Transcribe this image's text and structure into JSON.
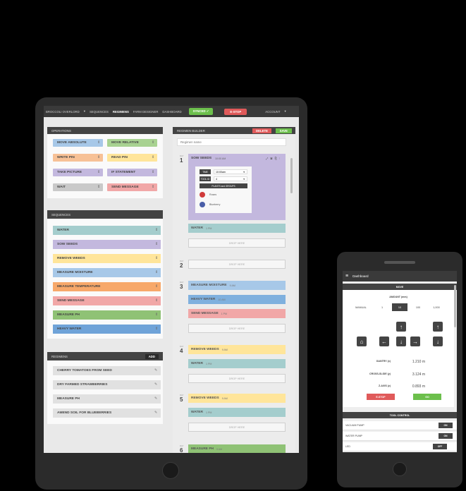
{
  "nav": {
    "device": "BROCCOLI OVERLORD",
    "device_caret": "▾",
    "items": [
      "SEQUENCES",
      "REGIMENS",
      "FARM DESIGNER",
      "DASHBOARD"
    ],
    "synced": "SYNCED ✓",
    "estop": "E-STOP",
    "account": "ACCOUNT",
    "account_caret": "▾"
  },
  "operations": {
    "title": "OPERATIONS",
    "items": [
      {
        "label": "MOVE ABSOLUTE",
        "color": "#a7c8e8"
      },
      {
        "label": "MOVE RELATIVE",
        "color": "#a8d291"
      },
      {
        "label": "WRITE PIN",
        "color": "#f7c196"
      },
      {
        "label": "READ PIN",
        "color": "#ffe59a"
      },
      {
        "label": "TAKE PICTURE",
        "color": "#c3b8de"
      },
      {
        "label": "IF STATEMENT",
        "color": "#c3b8de"
      },
      {
        "label": "WAIT",
        "color": "#c9c9c9"
      },
      {
        "label": "SEND MESSAGE",
        "color": "#f1a7a7"
      }
    ]
  },
  "sequences": {
    "title": "SEQUENCES",
    "items": [
      {
        "label": "WATER",
        "color": "#a4cdcd"
      },
      {
        "label": "SOW SEEDS",
        "color": "#c3b8de"
      },
      {
        "label": "REMOVE WEEDS",
        "color": "#ffe59a"
      },
      {
        "label": "MEASURE MOISTURE",
        "color": "#a7c8e8"
      },
      {
        "label": "MEASURE TEMPERATURE",
        "color": "#f7a86a"
      },
      {
        "label": "SEND MESSAGE",
        "color": "#f1a7a7"
      },
      {
        "label": "MEASURE PH",
        "color": "#8fc275"
      },
      {
        "label": "HEAVY WATER",
        "color": "#6fa3d8"
      }
    ]
  },
  "regimens": {
    "title": "REGIMENS",
    "add": "ADD",
    "items": [
      "CHERRY TOMATOES FROM SEED",
      "DRY FARMED STRAWBERRIES",
      "MEASURE PH",
      "AMEND SOIL FOR BLUEBERRIES"
    ]
  },
  "builder": {
    "title": "REGIMEN BUILDER",
    "delete": "DELETE",
    "save": "SAVE",
    "name_placeholder": "Regimen name",
    "day_label": "DAY",
    "drop": "DROP HERE",
    "sow": {
      "title": "SOW SEEDS",
      "time": "10:00 AM",
      "time_label": "TIME",
      "time_value": "10:00am",
      "tool_label": "TOOL ID",
      "tool_value": "4",
      "plants_header": "PLANTS and GROUPS",
      "plants": [
        "Roses",
        "Blueberry"
      ]
    },
    "days": [
      {
        "num": "1",
        "items": [
          {
            "label": "WATER",
            "time": "1 PM"
          }
        ]
      },
      {
        "num": "2",
        "items": []
      },
      {
        "num": "3",
        "items": [
          {
            "label": "MEASURE MOISTURE",
            "time": "9 AM"
          },
          {
            "label": "HEAVY WATER",
            "time": "10 AM"
          },
          {
            "label": "SEND MESSAGE",
            "time": "1 PM"
          }
        ]
      },
      {
        "num": "4",
        "items": [
          {
            "label": "REMOVE WEEDS",
            "time": "9 AM"
          },
          {
            "label": "WATER",
            "time": "1 PM"
          }
        ]
      },
      {
        "num": "5",
        "items": [
          {
            "label": "REMOVE WEEDS",
            "time": "9 AM"
          },
          {
            "label": "WATER",
            "time": "1 PM"
          }
        ]
      },
      {
        "num": "6",
        "items": [
          {
            "label": "MEASURE PH",
            "time": "9 AM"
          }
        ]
      }
    ]
  },
  "phone": {
    "title": "Dashboard",
    "move": "MOVE",
    "amount_label": "AMOUNT (mm)",
    "amounts": [
      "MANUAL",
      "1",
      "10",
      "100",
      "1,000"
    ],
    "selected_amount": "10",
    "positions": [
      {
        "label": "GANTRY (x)",
        "value": "1.210 m"
      },
      {
        "label": "CROSS-SLIDE (y)",
        "value": "3.124 m"
      },
      {
        "label": "Z-AXIS (z)",
        "value": "0.893 m"
      }
    ],
    "estop": "E-STOP",
    "go": "GO",
    "tool_control": "TOOL CONTROL",
    "tools": [
      {
        "label": "VACUUM PUMP",
        "state": "ON"
      },
      {
        "label": "WATER PUMP",
        "state": "ON"
      },
      {
        "label": "LED",
        "state": "OFF"
      }
    ]
  }
}
